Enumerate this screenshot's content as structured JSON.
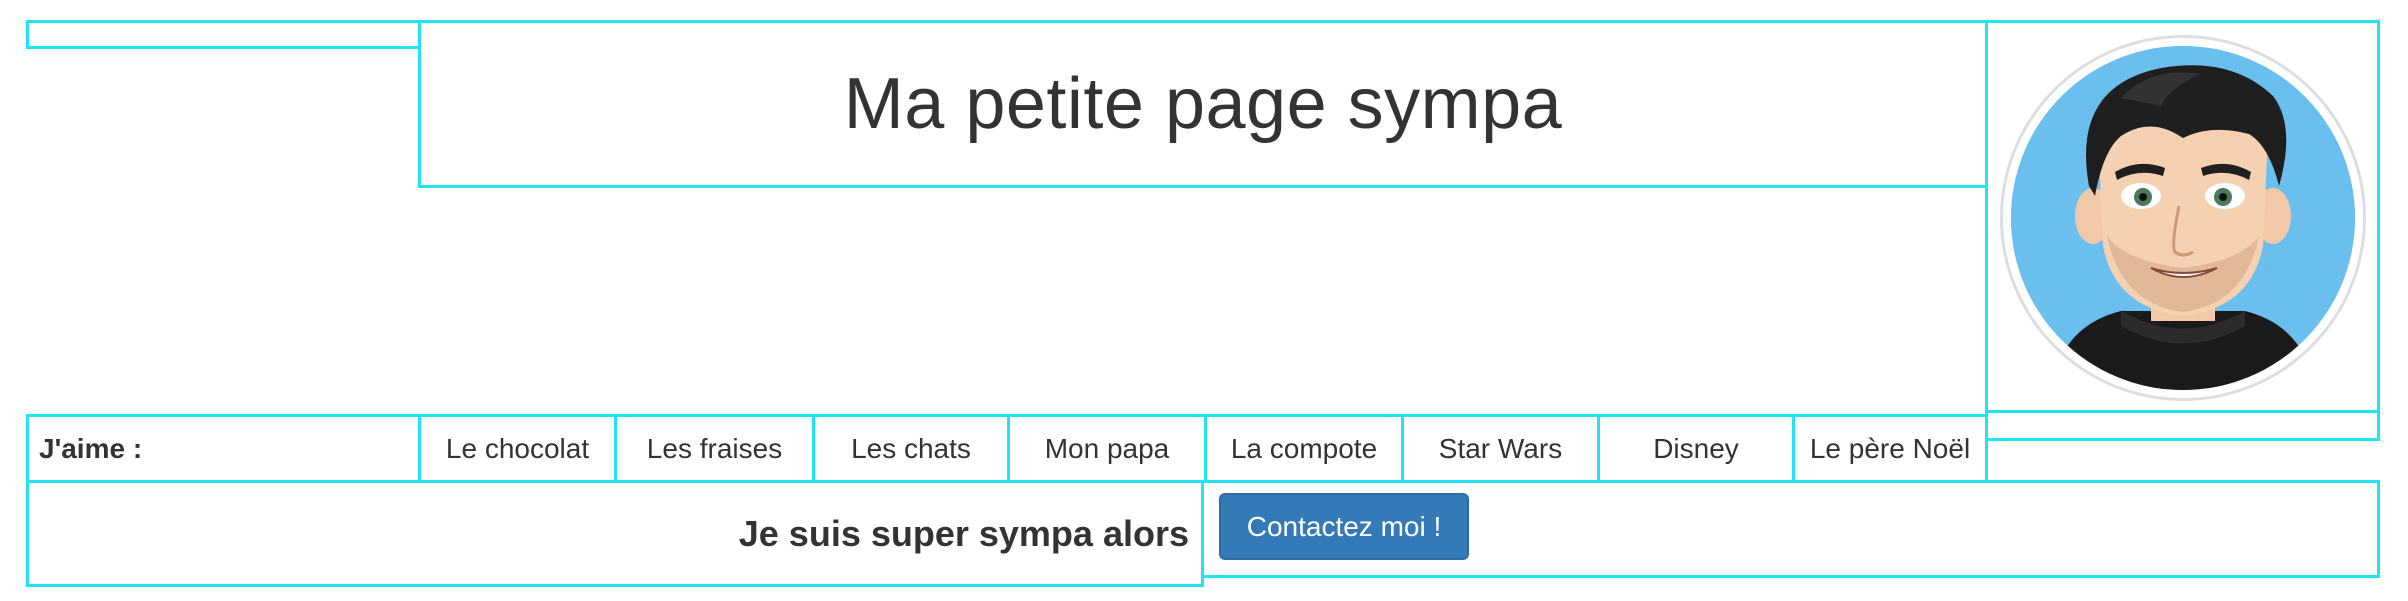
{
  "header": {
    "title": "Ma petite page sympa"
  },
  "avatar": {
    "icon": "avatar-cartoon-man"
  },
  "likes": {
    "label": "J'aime :",
    "items": [
      "Le chocolat",
      "Les fraises",
      "Les chats",
      "Mon papa",
      "La compote",
      "Star Wars",
      "Disney",
      "Le père Noël"
    ]
  },
  "footer": {
    "tagline": "Je suis super sympa alors",
    "contact_label": "Contactez moi !"
  },
  "colors": {
    "outline": "#22e3f5",
    "button": "#337ab7",
    "avatar_bg": "#6bbfef",
    "text": "#333333"
  }
}
